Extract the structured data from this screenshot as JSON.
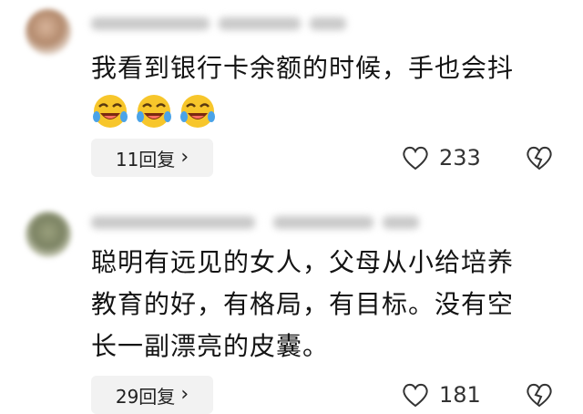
{
  "comments": [
    {
      "text": "我看到银行卡余额的时候，手也会抖",
      "emojis": [
        "rofl-emoji",
        "rofl-emoji",
        "rofl-emoji"
      ],
      "reply_label": "11回复",
      "likes": "233"
    },
    {
      "text_lines": [
        "聪明有远见的女人，父母从小给培养",
        "教育的好，有格局，有目标。没有空",
        "长一副漂亮的皮囊。"
      ],
      "reply_label": "29回复",
      "likes": "181"
    }
  ],
  "icons": {
    "heart": "heart-outline-icon",
    "broken_heart": "broken-heart-icon",
    "chevron": "chevron-right-icon"
  },
  "colors": {
    "pill_bg": "#f2f2f2",
    "text": "#141414",
    "icon": "#333333"
  }
}
